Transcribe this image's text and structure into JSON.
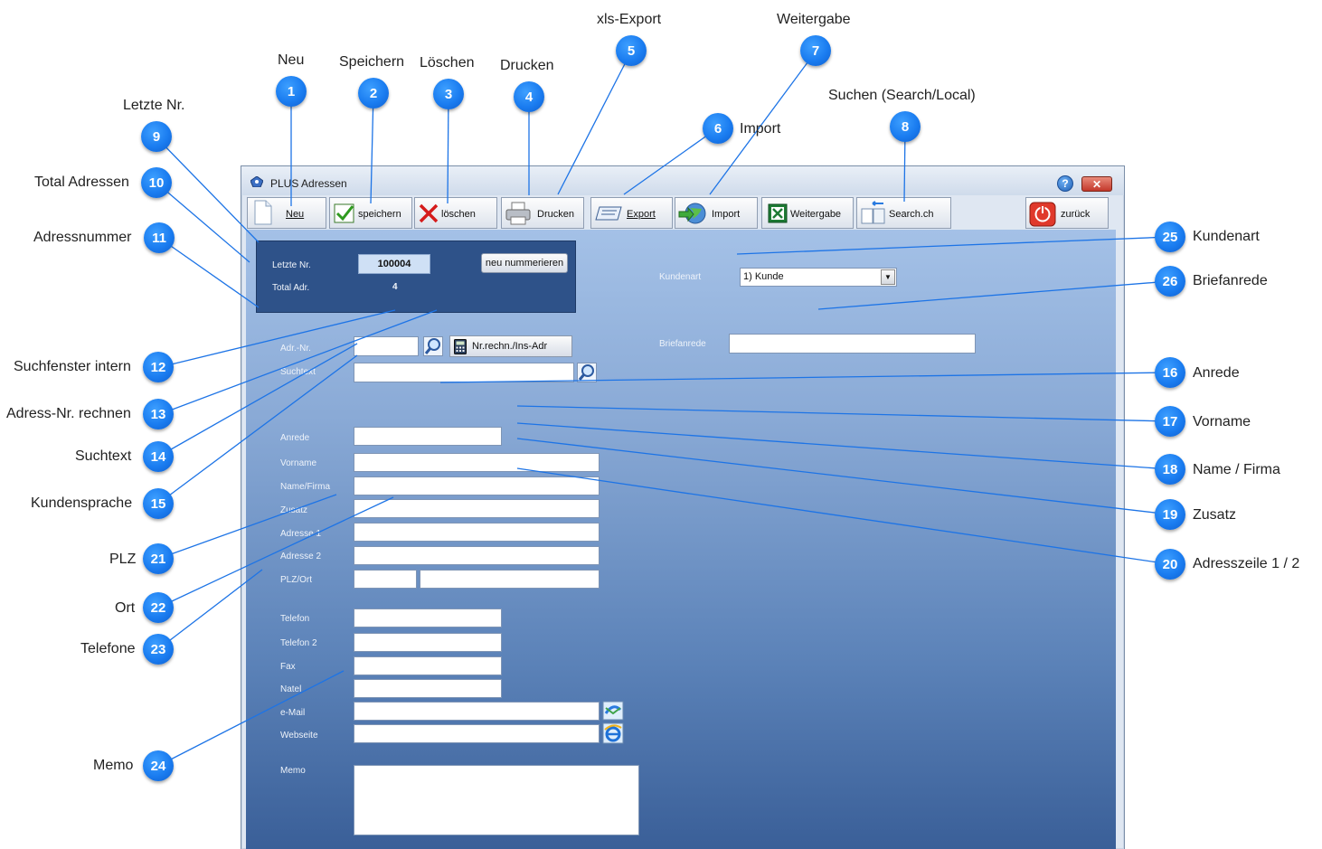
{
  "window": {
    "title": "PLUS Adressen",
    "help_icon": "?",
    "close_icon": "✕"
  },
  "toolbar": {
    "neu": "Neu",
    "speichern": "speichern",
    "loeschen": "löschen",
    "drucken": "Drucken",
    "export": "Export",
    "import": "Import",
    "weitergabe": "Weitergabe",
    "search": "Search.ch",
    "zurueck": "zurück"
  },
  "info_panel": {
    "letzte_nr_label": "Letzte Nr.",
    "letzte_nr_value": "100004",
    "total_label": "Total Adr.",
    "total_value": "4",
    "renumber_button": "neu nummerieren"
  },
  "form": {
    "adr_nr_label": "Adr.-Nr.",
    "nr_rechn_button": "Nr.rechn./Ins-Adr",
    "suchtext_label": "Suchtext",
    "anrede_label": "Anrede",
    "vorname_label": "Vorname",
    "name_firma_label": "Name/Firma",
    "zusatz_label": "Zusatz",
    "adresse1_label": "Adresse 1",
    "adresse2_label": "Adresse 2",
    "plz_ort_label": "PLZ/Ort",
    "telefon_label": "Telefon",
    "telefon2_label": "Telefon 2",
    "fax_label": "Fax",
    "natel_label": "Natel",
    "email_label": "e-Mail",
    "webseite_label": "Webseite",
    "memo_label": "Memo",
    "kundenart_label": "Kundenart",
    "kundenart_value": "1)   Kunde",
    "briefanrede_label": "Briefanrede"
  },
  "callouts": [
    {
      "num": "1",
      "label": "Neu"
    },
    {
      "num": "2",
      "label": "Speichern"
    },
    {
      "num": "3",
      "label": "Löschen"
    },
    {
      "num": "4",
      "label": "Drucken"
    },
    {
      "num": "5",
      "label": "xls-Export"
    },
    {
      "num": "6",
      "label": "Import"
    },
    {
      "num": "7",
      "label": "Weitergabe"
    },
    {
      "num": "8",
      "label": "Suchen (Search/Local)"
    },
    {
      "num": "9",
      "label": "Letzte Nr."
    },
    {
      "num": "10",
      "label": "Total Adressen"
    },
    {
      "num": "11",
      "label": "Adressnummer"
    },
    {
      "num": "12",
      "label": "Suchfenster intern"
    },
    {
      "num": "13",
      "label": "Adress-Nr. rechnen"
    },
    {
      "num": "14",
      "label": "Suchtext"
    },
    {
      "num": "15",
      "label": "Kundensprache"
    },
    {
      "num": "16",
      "label": "Anrede"
    },
    {
      "num": "17",
      "label": "Vorname"
    },
    {
      "num": "18",
      "label": "Name / Firma"
    },
    {
      "num": "19",
      "label": "Zusatz"
    },
    {
      "num": "20",
      "label": "Adresszeile 1 / 2"
    },
    {
      "num": "21",
      "label": "PLZ"
    },
    {
      "num": "22",
      "label": "Ort"
    },
    {
      "num": "23",
      "label": "Telefone"
    },
    {
      "num": "24",
      "label": "Memo"
    },
    {
      "num": "25",
      "label": "Kundenart"
    },
    {
      "num": "26",
      "label": "Briefanrede"
    }
  ]
}
